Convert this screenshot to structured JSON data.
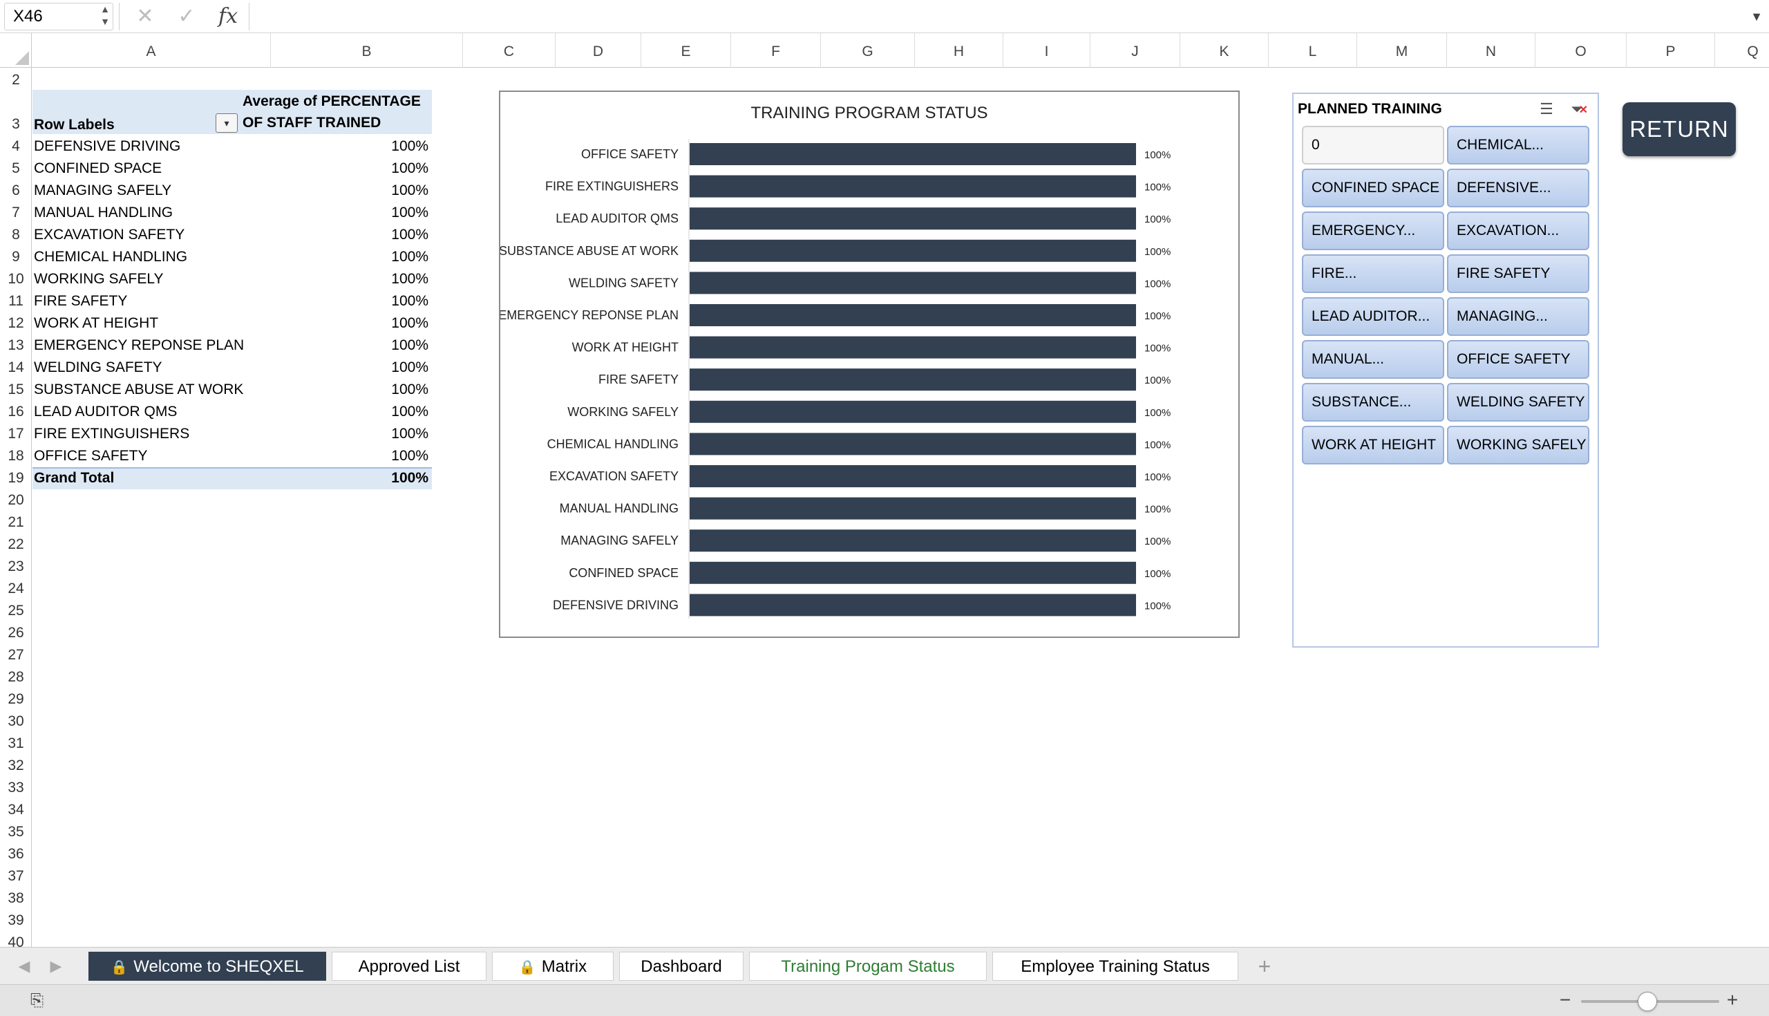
{
  "formula_bar": {
    "cell_ref": "X46",
    "cancel_icon": "x-icon",
    "enter_icon": "check-icon",
    "function_label": "fx",
    "formula": ""
  },
  "columns": [
    "A",
    "B",
    "C",
    "D",
    "E",
    "F",
    "G",
    "H",
    "I",
    "J",
    "K",
    "L",
    "M",
    "N",
    "O",
    "P",
    "Q"
  ],
  "rows": [
    "2",
    "3",
    "4",
    "5",
    "6",
    "7",
    "8",
    "9",
    "10",
    "11",
    "12",
    "13",
    "14",
    "15",
    "16",
    "17",
    "18",
    "19",
    "20",
    "21",
    "22",
    "23",
    "24",
    "25",
    "26",
    "27",
    "28",
    "29",
    "30",
    "31",
    "32",
    "33",
    "34",
    "35",
    "36",
    "37",
    "38",
    "39",
    "40"
  ],
  "pivot": {
    "row_labels_header": "Row Labels",
    "value_header_line1": "Average of PERCENTAGE",
    "value_header_line2": "OF STAFF TRAINED",
    "rows": [
      {
        "label": "DEFENSIVE DRIVING",
        "value": "100%"
      },
      {
        "label": "CONFINED SPACE",
        "value": "100%"
      },
      {
        "label": "MANAGING SAFELY",
        "value": "100%"
      },
      {
        "label": "MANUAL HANDLING",
        "value": "100%"
      },
      {
        "label": "EXCAVATION SAFETY",
        "value": "100%"
      },
      {
        "label": "CHEMICAL HANDLING",
        "value": "100%"
      },
      {
        "label": "WORKING SAFELY",
        "value": "100%"
      },
      {
        "label": "FIRE SAFETY",
        "value": "100%"
      },
      {
        "label": "WORK AT HEIGHT",
        "value": "100%"
      },
      {
        "label": "EMERGENCY REPONSE PLAN",
        "value": "100%"
      },
      {
        "label": "WELDING SAFETY",
        "value": "100%"
      },
      {
        "label": "SUBSTANCE ABUSE AT WORK",
        "value": "100%"
      },
      {
        "label": "LEAD AUDITOR QMS",
        "value": "100%"
      },
      {
        "label": "FIRE EXTINGUISHERS",
        "value": "100%"
      },
      {
        "label": "OFFICE SAFETY",
        "value": "100%"
      }
    ],
    "grand_total_label": "Grand Total",
    "grand_total_value": "100%"
  },
  "chart_data": {
    "type": "bar",
    "orientation": "horizontal",
    "title": "TRAINING PROGRAM STATUS",
    "categories": [
      "OFFICE SAFETY",
      "FIRE EXTINGUISHERS",
      "LEAD AUDITOR QMS",
      "SUBSTANCE ABUSE AT WORK",
      "WELDING SAFETY",
      "EMERGENCY REPONSE PLAN",
      "WORK AT HEIGHT",
      "FIRE SAFETY",
      "WORKING SAFELY",
      "CHEMICAL HANDLING",
      "EXCAVATION SAFETY",
      "MANUAL HANDLING",
      "MANAGING SAFELY",
      "CONFINED SPACE",
      "DEFENSIVE DRIVING"
    ],
    "values": [
      1,
      1,
      1,
      1,
      1,
      1,
      1,
      1,
      1,
      1,
      1,
      1,
      1,
      1,
      1
    ],
    "data_labels": [
      "100%",
      "100%",
      "100%",
      "100%",
      "100%",
      "100%",
      "100%",
      "100%",
      "100%",
      "100%",
      "100%",
      "100%",
      "100%",
      "100%",
      "100%"
    ],
    "xlim": [
      0,
      1
    ],
    "bar_color": "#324052",
    "grid": false,
    "legend": "none"
  },
  "slicer": {
    "title": "PLANNED TRAINING",
    "multiselect_icon": "multi-select-icon",
    "clear_icon": "clear-filter-icon",
    "items": [
      "0",
      "CHEMICAL...",
      "CONFINED SPACE",
      "DEFENSIVE...",
      "EMERGENCY...",
      "EXCAVATION...",
      "FIRE...",
      "FIRE SAFETY",
      "LEAD AUDITOR...",
      "MANAGING...",
      "MANUAL...",
      "OFFICE SAFETY",
      "SUBSTANCE...",
      "WELDING SAFETY",
      "WORK AT HEIGHT",
      "WORKING SAFELY"
    ]
  },
  "return_button": "RETURN",
  "tabs": [
    {
      "label": "Welcome to SHEQXEL",
      "locked": true
    },
    {
      "label": "Approved List",
      "locked": false
    },
    {
      "label": "Matrix",
      "locked": true
    },
    {
      "label": "Dashboard",
      "locked": false
    },
    {
      "label": "Training Progam Status",
      "locked": false
    },
    {
      "label": "Employee Training Status",
      "locked": false
    }
  ],
  "tab_add": "+",
  "colors": {
    "accent_dark": "#324052",
    "active_tab": "#2e7d32",
    "pivot_header": "#dde8f5",
    "slicer_button": "#c9d8f0"
  }
}
